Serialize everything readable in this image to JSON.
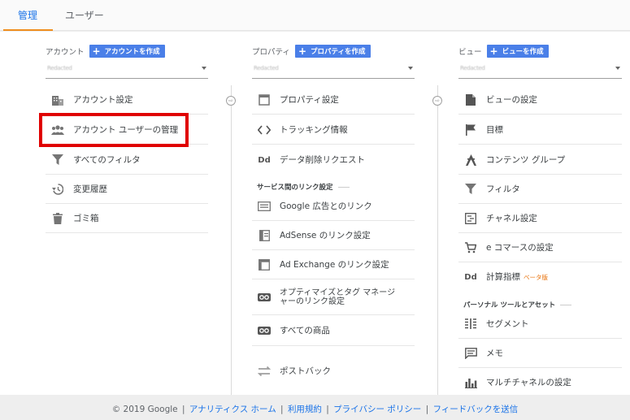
{
  "tabs": [
    {
      "label": "管理",
      "active": true
    },
    {
      "label": "ユーザー",
      "active": false
    }
  ],
  "account_col": {
    "label": "アカウント",
    "create_label": "アカウントを作成",
    "selector_value": "Redacted",
    "items": [
      {
        "label": "アカウント設定",
        "icon": "building-icon"
      },
      {
        "label": "アカウント ユーザーの管理",
        "icon": "people-icon"
      },
      {
        "label": "すべてのフィルタ",
        "icon": "filter-icon"
      },
      {
        "label": "変更履歴",
        "icon": "history-icon"
      },
      {
        "label": "ゴミ箱",
        "icon": "trash-icon"
      }
    ]
  },
  "property_col": {
    "label": "プロパティ",
    "create_label": "プロパティを作成",
    "selector_value": "Redacted",
    "items": [
      {
        "label": "プロパティ設定",
        "icon": "window-icon"
      },
      {
        "label": "トラッキング情報",
        "icon": "code-icon"
      },
      {
        "label": "データ削除リクエスト",
        "icon": "dd-icon",
        "glyph": "Dd"
      }
    ],
    "section_label": "サービス間のリンク設定",
    "link_items": [
      {
        "label": "Google 広告とのリンク",
        "icon": "ads-icon"
      },
      {
        "label": "AdSense のリンク設定",
        "icon": "adsense-icon"
      },
      {
        "label": "Ad Exchange のリンク設定",
        "icon": "adexchange-icon"
      },
      {
        "label": "オプティマイズとタグ マネージャーのリンク設定",
        "icon": "link-icon"
      },
      {
        "label": "すべての商品",
        "icon": "link-icon"
      }
    ],
    "postback_label": "ポストバック"
  },
  "view_col": {
    "label": "ビュー",
    "create_label": "ビューを作成",
    "selector_value": "Redacted",
    "items": [
      {
        "label": "ビューの設定",
        "icon": "document-icon"
      },
      {
        "label": "目標",
        "icon": "flag-icon"
      },
      {
        "label": "コンテンツ グループ",
        "icon": "person-walk-icon"
      },
      {
        "label": "フィルタ",
        "icon": "filter-icon"
      },
      {
        "label": "チャネル設定",
        "icon": "channel-icon"
      },
      {
        "label": "e コマースの設定",
        "icon": "cart-icon"
      },
      {
        "label": "計算指標",
        "icon": "dd-icon",
        "glyph": "Dd",
        "badge": "ベータ版"
      }
    ],
    "section_label": "パーソナル ツールとアセット",
    "personal_items": [
      {
        "label": "セグメント",
        "icon": "segment-icon"
      },
      {
        "label": "メモ",
        "icon": "comment-icon"
      },
      {
        "label": "マルチチャネルの設定",
        "icon": "bar-chart-icon"
      }
    ]
  },
  "footer": {
    "copyright": "© 2019 Google",
    "links": [
      "アナリティクス ホーム",
      "利用規約",
      "プライバシー ポリシー",
      "フィードバックを送信"
    ]
  },
  "colors": {
    "accent": "#1a73e8",
    "create_button": "#4a7fe8",
    "tab_underline": "#ef8d1e",
    "highlight": "#e00000"
  }
}
